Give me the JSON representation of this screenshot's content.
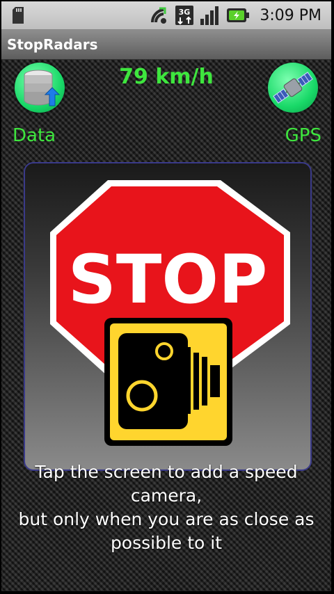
{
  "status_bar": {
    "time": "3:09 PM",
    "icons": [
      "sd-card-icon",
      "signal-arrow-icon",
      "3g-icon",
      "signal-bars-icon",
      "battery-charging-icon"
    ],
    "network_type": "3G"
  },
  "app": {
    "title": "StopRadars"
  },
  "speed": {
    "text": "79 km/h"
  },
  "buttons": {
    "data_label": "Data",
    "gps_label": "GPS",
    "data_icon": "database-upload-icon",
    "gps_icon": "satellite-icon"
  },
  "sign": {
    "text": "STOP",
    "colors": {
      "octagon_fill": "#e8141b",
      "octagon_border": "#ffffff",
      "camera_plate": "#ffd52e",
      "camera_body": "#000000"
    }
  },
  "instruction": {
    "line1": "Tap the screen to add a speed camera,",
    "line2": "but only when you are as close as",
    "line3": "possible to it"
  },
  "colors": {
    "accent_green": "#3ee63e",
    "panel_border": "#3a3a8a"
  }
}
